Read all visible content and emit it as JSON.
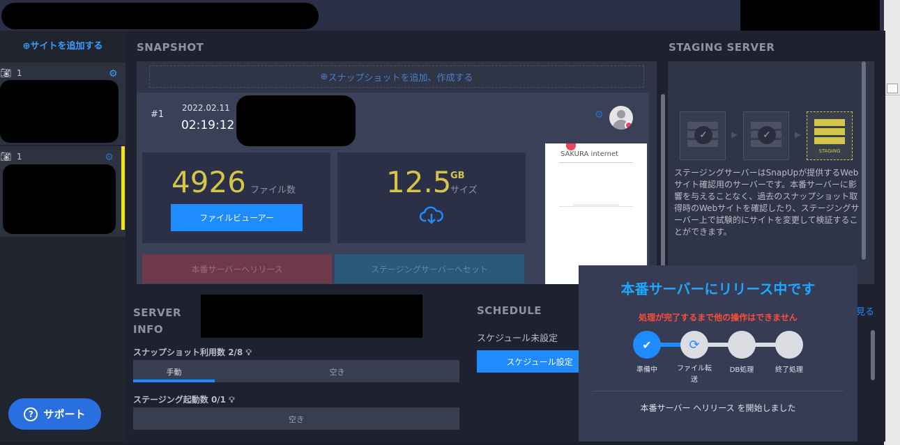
{
  "sidebar": {
    "add_site_label": "サイトを追加する",
    "sites": [
      {
        "snapshot_count": "1"
      },
      {
        "snapshot_count": "1"
      }
    ],
    "support_label": "サポート"
  },
  "snapshot": {
    "section_title": "SNAPSHOT",
    "add_label": "スナップショットを追加、作成する",
    "entry": {
      "number": "#1",
      "date": "2022.02.11",
      "time": "02:19:12",
      "file_count": "4926",
      "file_count_label": "ファイル数",
      "size_value": "12.5",
      "size_unit": "GB",
      "size_label": "サイズ",
      "file_viewer_label": "ファイルビューアー",
      "release_label": "本番サーバーへリリース",
      "staging_label": "ステージングサーバーへセット",
      "preview_brand": "SAKURA internet"
    }
  },
  "staging": {
    "section_title": "STAGING SERVER",
    "active_server_label": "STAGING",
    "description": "ステージングサーバーはSnapUpが提供するWebサイト確認用のサーバーです。本番サーバーに影響を与えることなく、過去のスナップショット取得時のWebサイトを確認したり、ステージングサーバー上で試験的にサイトを変更して検証することができます。"
  },
  "server_info": {
    "title_line1": "SERVER",
    "title_line2": "INFO",
    "snapshot_usage_label": "スナップショット利用数",
    "snapshot_usage_value": "2/8",
    "manual_label": "手動",
    "empty_label": "空き",
    "staging_usage_label": "ステージング起動数",
    "staging_usage_value": "0/1",
    "staging_empty_label": "空き",
    "manual_fraction": 0.25
  },
  "schedule": {
    "title": "SCHEDULE",
    "status": "スケジュール未設定",
    "button_label": "スケジュール設定",
    "more_link": "見る"
  },
  "modal": {
    "title": "本番サーバーにリリース中です",
    "warning": "処理が完了するまで他の操作はできません",
    "steps": [
      {
        "label": "準備中",
        "state": "done"
      },
      {
        "label": "ファイル転送",
        "state": "active"
      },
      {
        "label": "DB処理",
        "state": "pending"
      },
      {
        "label": "終了処理",
        "state": "pending"
      }
    ],
    "footer": "本番サーバー ヘリリース を開始しました"
  },
  "colors": {
    "accent_blue": "#1e8bff",
    "highlight_yellow": "#d4c64a",
    "warning_red": "#ff4d3a"
  }
}
